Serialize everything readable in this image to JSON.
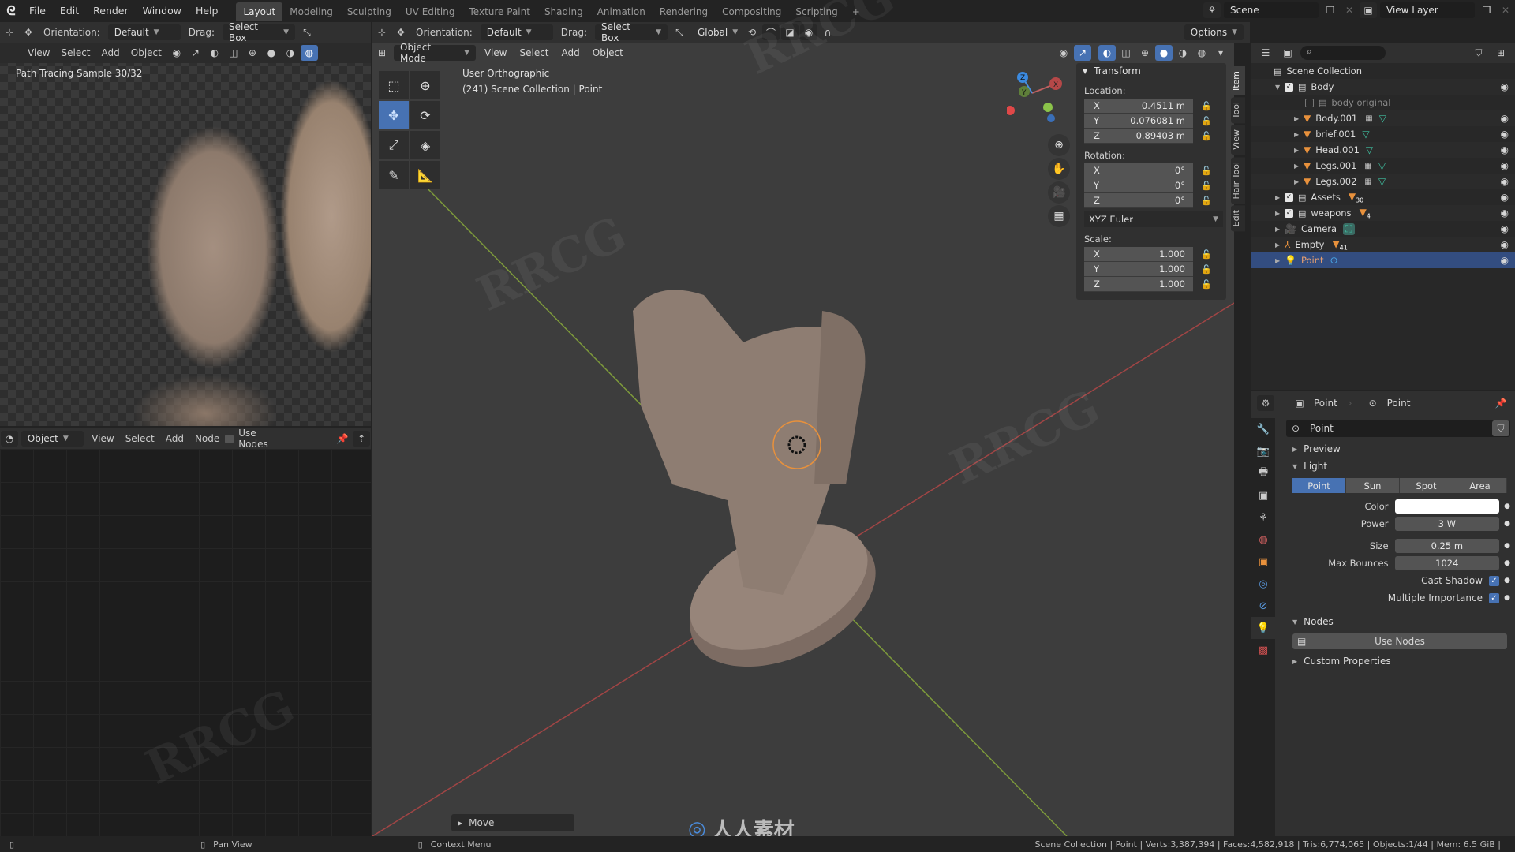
{
  "topbar": {
    "menus": [
      "File",
      "Edit",
      "Render",
      "Window",
      "Help"
    ],
    "workspaces": [
      "Layout",
      "Modeling",
      "Sculpting",
      "UV Editing",
      "Texture Paint",
      "Shading",
      "Animation",
      "Rendering",
      "Compositing",
      "Scripting"
    ],
    "active_workspace": "Layout",
    "add_tab": "+",
    "scene": "Scene",
    "view_layer": "View Layer"
  },
  "tool_header_left": {
    "orientation_label": "Orientation:",
    "orientation_value": "Default",
    "drag_label": "Drag:",
    "drag_value": "Select Box"
  },
  "tool_header_right": {
    "orientation_label": "Orientation:",
    "orientation_value": "Default",
    "drag_label": "Drag:",
    "drag_value": "Select Box",
    "transform_orientation": "Global",
    "options": "Options"
  },
  "render_view": {
    "menus": [
      "View",
      "Select",
      "Add",
      "Object"
    ],
    "status": "Path Tracing Sample 30/32"
  },
  "node_editor": {
    "type": "Object",
    "menus": [
      "View",
      "Select",
      "Add",
      "Node"
    ],
    "use_nodes": "Use Nodes"
  },
  "viewport": {
    "mode": "Object Mode",
    "menus": [
      "View",
      "Select",
      "Add",
      "Object"
    ],
    "view_name": "User Orthographic",
    "context": "(241) Scene Collection | Point",
    "last_op": "Move",
    "gizmo_axes": [
      "X",
      "Y",
      "Z"
    ]
  },
  "npanel": {
    "title": "Transform",
    "location_label": "Location:",
    "location": [
      {
        "axis": "X",
        "value": "0.4511 m"
      },
      {
        "axis": "Y",
        "value": "0.076081 m"
      },
      {
        "axis": "Z",
        "value": "0.89403 m"
      }
    ],
    "rotation_label": "Rotation:",
    "rotation": [
      {
        "axis": "X",
        "value": "0°"
      },
      {
        "axis": "Y",
        "value": "0°"
      },
      {
        "axis": "Z",
        "value": "0°"
      }
    ],
    "rotation_mode": "XYZ Euler",
    "scale_label": "Scale:",
    "scale": [
      {
        "axis": "X",
        "value": "1.000"
      },
      {
        "axis": "Y",
        "value": "1.000"
      },
      {
        "axis": "Z",
        "value": "1.000"
      }
    ],
    "tabs": [
      "Item",
      "Tool",
      "View",
      "Hair Tool",
      "Edit"
    ]
  },
  "outliner": {
    "root": "Scene Collection",
    "rows": [
      {
        "name": "Body",
        "kind": "collection",
        "checked": true
      },
      {
        "name": "body original",
        "kind": "collection",
        "checked": false
      },
      {
        "name": "Body.001",
        "kind": "mesh"
      },
      {
        "name": "brief.001",
        "kind": "mesh"
      },
      {
        "name": "Head.001",
        "kind": "mesh"
      },
      {
        "name": "Legs.001",
        "kind": "mesh"
      },
      {
        "name": "Legs.002",
        "kind": "mesh"
      },
      {
        "name": "Assets",
        "kind": "collection",
        "checked": true,
        "count": "30"
      },
      {
        "name": "weapons",
        "kind": "collection",
        "checked": true,
        "count": "4"
      },
      {
        "name": "Camera",
        "kind": "camera"
      },
      {
        "name": "Empty",
        "kind": "empty",
        "count": "41"
      },
      {
        "name": "Point",
        "kind": "light",
        "selected": true
      }
    ]
  },
  "properties": {
    "breadcrumb": [
      "Point",
      "Point"
    ],
    "datablock": "Point",
    "sections": {
      "preview": "Preview",
      "light": "Light",
      "nodes": "Nodes",
      "custom": "Custom Properties"
    },
    "light_types": [
      "Point",
      "Sun",
      "Spot",
      "Area"
    ],
    "active_light_type": "Point",
    "color_label": "Color",
    "color_value": "#ffffff",
    "power_label": "Power",
    "power": "3 W",
    "size_label": "Size",
    "size": "0.25 m",
    "max_bounces_label": "Max Bounces",
    "max_bounces": "1024",
    "cast_shadow_label": "Cast Shadow",
    "cast_shadow": true,
    "mis_label": "Multiple Importance",
    "mis": true,
    "use_nodes_button": "Use Nodes"
  },
  "statusbar": {
    "left_hint": "",
    "middle_hint": "Pan View",
    "right_hint": "Context Menu",
    "stats": "Scene Collection | Point | Verts:3,387,394 | Faces:4,582,918 | Tris:6,774,065 | Objects:1/44 | Mem: 6.5 GiB |"
  },
  "watermarks": {
    "brand": "RRCG",
    "cn": "人人素材"
  },
  "colors": {
    "accent": "#4772b3",
    "selected_row": "#334d80",
    "axis_x": "#e04848",
    "axis_y": "#8bc34a",
    "axis_z": "#3b8ae0"
  }
}
